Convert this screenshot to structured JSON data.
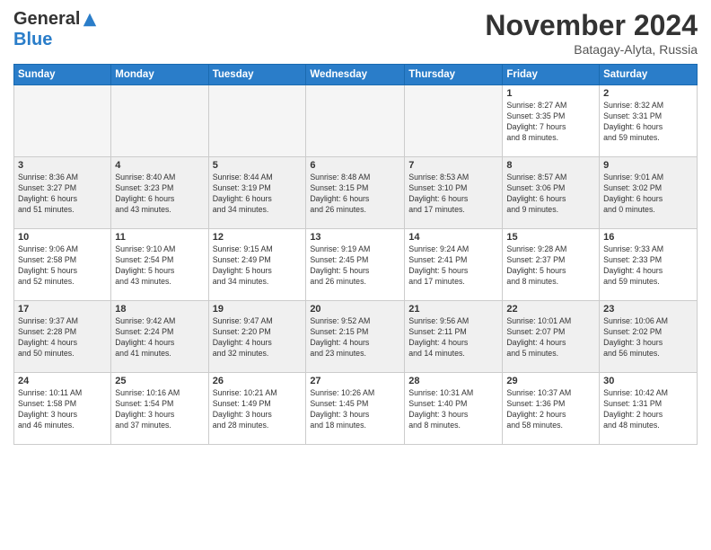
{
  "header": {
    "logo_general": "General",
    "logo_blue": "Blue",
    "month_title": "November 2024",
    "location": "Batagay-Alyta, Russia"
  },
  "weekdays": [
    "Sunday",
    "Monday",
    "Tuesday",
    "Wednesday",
    "Thursday",
    "Friday",
    "Saturday"
  ],
  "weeks": [
    [
      {
        "day": "",
        "info": ""
      },
      {
        "day": "",
        "info": ""
      },
      {
        "day": "",
        "info": ""
      },
      {
        "day": "",
        "info": ""
      },
      {
        "day": "",
        "info": ""
      },
      {
        "day": "1",
        "info": "Sunrise: 8:27 AM\nSunset: 3:35 PM\nDaylight: 7 hours\nand 8 minutes."
      },
      {
        "day": "2",
        "info": "Sunrise: 8:32 AM\nSunset: 3:31 PM\nDaylight: 6 hours\nand 59 minutes."
      }
    ],
    [
      {
        "day": "3",
        "info": "Sunrise: 8:36 AM\nSunset: 3:27 PM\nDaylight: 6 hours\nand 51 minutes."
      },
      {
        "day": "4",
        "info": "Sunrise: 8:40 AM\nSunset: 3:23 PM\nDaylight: 6 hours\nand 43 minutes."
      },
      {
        "day": "5",
        "info": "Sunrise: 8:44 AM\nSunset: 3:19 PM\nDaylight: 6 hours\nand 34 minutes."
      },
      {
        "day": "6",
        "info": "Sunrise: 8:48 AM\nSunset: 3:15 PM\nDaylight: 6 hours\nand 26 minutes."
      },
      {
        "day": "7",
        "info": "Sunrise: 8:53 AM\nSunset: 3:10 PM\nDaylight: 6 hours\nand 17 minutes."
      },
      {
        "day": "8",
        "info": "Sunrise: 8:57 AM\nSunset: 3:06 PM\nDaylight: 6 hours\nand 9 minutes."
      },
      {
        "day": "9",
        "info": "Sunrise: 9:01 AM\nSunset: 3:02 PM\nDaylight: 6 hours\nand 0 minutes."
      }
    ],
    [
      {
        "day": "10",
        "info": "Sunrise: 9:06 AM\nSunset: 2:58 PM\nDaylight: 5 hours\nand 52 minutes."
      },
      {
        "day": "11",
        "info": "Sunrise: 9:10 AM\nSunset: 2:54 PM\nDaylight: 5 hours\nand 43 minutes."
      },
      {
        "day": "12",
        "info": "Sunrise: 9:15 AM\nSunset: 2:49 PM\nDaylight: 5 hours\nand 34 minutes."
      },
      {
        "day": "13",
        "info": "Sunrise: 9:19 AM\nSunset: 2:45 PM\nDaylight: 5 hours\nand 26 minutes."
      },
      {
        "day": "14",
        "info": "Sunrise: 9:24 AM\nSunset: 2:41 PM\nDaylight: 5 hours\nand 17 minutes."
      },
      {
        "day": "15",
        "info": "Sunrise: 9:28 AM\nSunset: 2:37 PM\nDaylight: 5 hours\nand 8 minutes."
      },
      {
        "day": "16",
        "info": "Sunrise: 9:33 AM\nSunset: 2:33 PM\nDaylight: 4 hours\nand 59 minutes."
      }
    ],
    [
      {
        "day": "17",
        "info": "Sunrise: 9:37 AM\nSunset: 2:28 PM\nDaylight: 4 hours\nand 50 minutes."
      },
      {
        "day": "18",
        "info": "Sunrise: 9:42 AM\nSunset: 2:24 PM\nDaylight: 4 hours\nand 41 minutes."
      },
      {
        "day": "19",
        "info": "Sunrise: 9:47 AM\nSunset: 2:20 PM\nDaylight: 4 hours\nand 32 minutes."
      },
      {
        "day": "20",
        "info": "Sunrise: 9:52 AM\nSunset: 2:15 PM\nDaylight: 4 hours\nand 23 minutes."
      },
      {
        "day": "21",
        "info": "Sunrise: 9:56 AM\nSunset: 2:11 PM\nDaylight: 4 hours\nand 14 minutes."
      },
      {
        "day": "22",
        "info": "Sunrise: 10:01 AM\nSunset: 2:07 PM\nDaylight: 4 hours\nand 5 minutes."
      },
      {
        "day": "23",
        "info": "Sunrise: 10:06 AM\nSunset: 2:02 PM\nDaylight: 3 hours\nand 56 minutes."
      }
    ],
    [
      {
        "day": "24",
        "info": "Sunrise: 10:11 AM\nSunset: 1:58 PM\nDaylight: 3 hours\nand 46 minutes."
      },
      {
        "day": "25",
        "info": "Sunrise: 10:16 AM\nSunset: 1:54 PM\nDaylight: 3 hours\nand 37 minutes."
      },
      {
        "day": "26",
        "info": "Sunrise: 10:21 AM\nSunset: 1:49 PM\nDaylight: 3 hours\nand 28 minutes."
      },
      {
        "day": "27",
        "info": "Sunrise: 10:26 AM\nSunset: 1:45 PM\nDaylight: 3 hours\nand 18 minutes."
      },
      {
        "day": "28",
        "info": "Sunrise: 10:31 AM\nSunset: 1:40 PM\nDaylight: 3 hours\nand 8 minutes."
      },
      {
        "day": "29",
        "info": "Sunrise: 10:37 AM\nSunset: 1:36 PM\nDaylight: 2 hours\nand 58 minutes."
      },
      {
        "day": "30",
        "info": "Sunrise: 10:42 AM\nSunset: 1:31 PM\nDaylight: 2 hours\nand 48 minutes."
      }
    ]
  ]
}
